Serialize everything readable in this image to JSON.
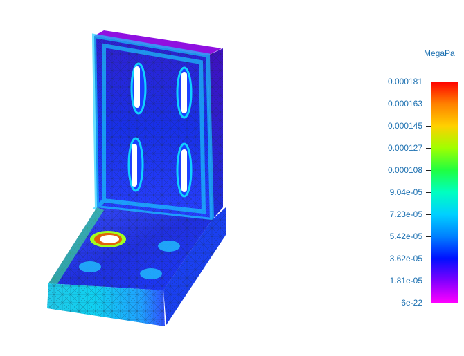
{
  "legend": {
    "unit": "MegaPa",
    "ticks": [
      "0.000181",
      "0.000163",
      "0.000145",
      "0.000127",
      "0.000108",
      "9.04e-05",
      "7.23e-05",
      "5.42e-05",
      "3.62e-05",
      "1.81e-05",
      "6e-22"
    ]
  },
  "colors": {
    "legend_text": "#1a6fb0",
    "mesh_line": "#1a2a3a",
    "max": "#ff0000",
    "min": "#ff00ff"
  }
}
